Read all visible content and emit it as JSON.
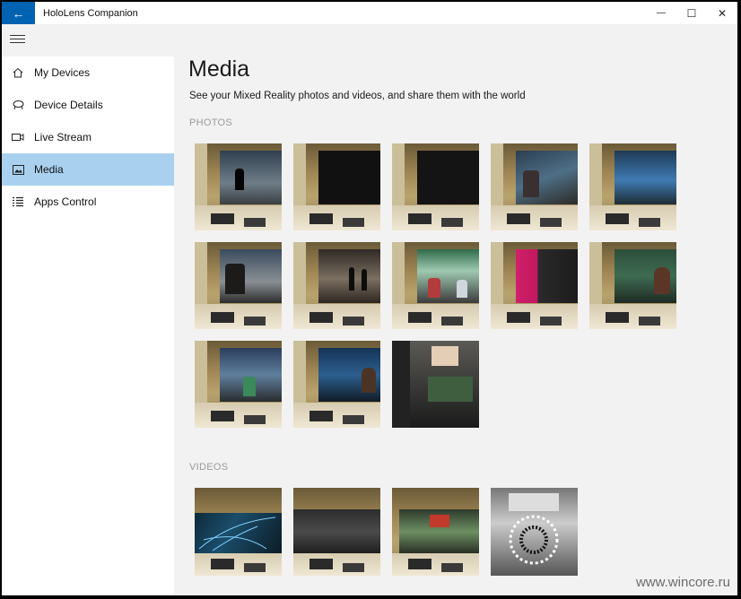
{
  "titlebar": {
    "back_glyph": "←",
    "title": "HoloLens Companion",
    "minimize_glyph": "—",
    "maximize_glyph": "☐",
    "close_glyph": "✕"
  },
  "sidebar": {
    "items": [
      {
        "label": "My Devices",
        "icon": "home-icon"
      },
      {
        "label": "Device Details",
        "icon": "device-details-icon"
      },
      {
        "label": "Live Stream",
        "icon": "camera-icon"
      },
      {
        "label": "Media",
        "icon": "media-icon",
        "active": true
      },
      {
        "label": "Apps Control",
        "icon": "list-icon"
      }
    ]
  },
  "main": {
    "title": "Media",
    "subtitle": "See your Mixed Reality photos and videos, and share them with the world",
    "photos_label": "PHOTOS",
    "videos_label": "VIDEOS"
  },
  "watermark": "www.wincore.ru",
  "colors": {
    "accent": "#0063b1",
    "active_nav": "#a9d1ef"
  }
}
